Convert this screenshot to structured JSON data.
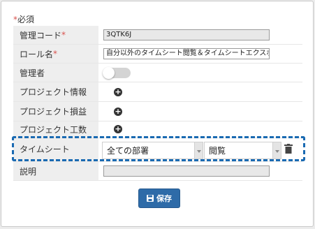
{
  "form": {
    "required_mark": "*",
    "required_note": "必須",
    "fields": {
      "code": {
        "label": "管理コード",
        "required": "*",
        "value": "3QTK6J"
      },
      "role_name": {
        "label": "ロール名",
        "required": "*",
        "value": "自分以外のタイムシート閲覧＆タイムシートエクスポート"
      },
      "admin": {
        "label": "管理者",
        "toggle_on": false
      },
      "project_info": {
        "label": "プロジェクト情報"
      },
      "project_profit": {
        "label": "プロジェクト損益"
      },
      "project_effort": {
        "label": "プロジェクト工数"
      },
      "timesheet": {
        "label": "タイムシート",
        "scope_value": "全ての部署",
        "permission_value": "閲覧"
      },
      "description": {
        "label": "説明",
        "value": ""
      }
    },
    "save_label": "保存"
  },
  "colors": {
    "accent": "#2e6ba8",
    "highlight": "#1a6ab2",
    "required": "#d9534f",
    "label_bg": "#eeeeee"
  },
  "icons": {
    "add": "plus-circle-icon",
    "delete": "trash-icon",
    "save": "floppy-disk-icon"
  }
}
